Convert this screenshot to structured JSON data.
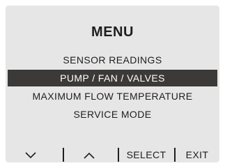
{
  "screen": {
    "title": "MENU",
    "items": [
      {
        "label": "SENSOR READINGS",
        "selected": false
      },
      {
        "label": "PUMP / FAN / VALVES",
        "selected": true
      },
      {
        "label": "MAXIMUM FLOW TEMPERATURE",
        "selected": false
      },
      {
        "label": "SERVICE MODE",
        "selected": false
      }
    ]
  },
  "softkeys": {
    "down_icon": "chevron-down-icon",
    "up_icon": "chevron-up-icon",
    "select_label": "SELECT",
    "exit_label": "EXIT"
  },
  "colors": {
    "panel_bg": "#e6e6e6",
    "highlight_bg": "#3b3a38",
    "text": "#1e1e1e",
    "highlight_text": "#ffffff"
  }
}
